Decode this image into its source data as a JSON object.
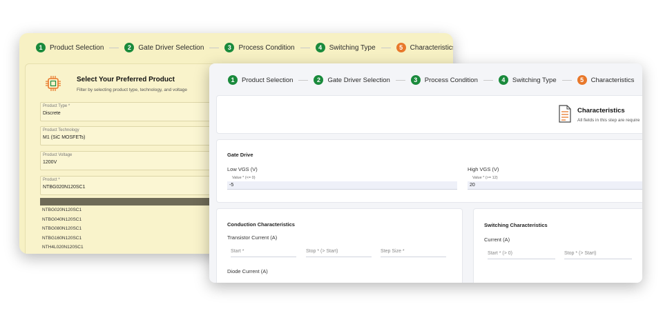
{
  "steps": [
    {
      "num": "1",
      "label": "Product Selection"
    },
    {
      "num": "2",
      "label": "Gate Driver Selection"
    },
    {
      "num": "3",
      "label": "Process Condition"
    },
    {
      "num": "4",
      "label": "Switching Type"
    },
    {
      "num": "5",
      "label": "Characteristics"
    }
  ],
  "product": {
    "title": "Select Your Preferred Product",
    "subtitle": "Filter by selecting product type, technology, and voltage",
    "fields": [
      {
        "label": "Product Type *",
        "value": "Discrete"
      },
      {
        "label": "Product Technology",
        "value": "M1 (SiC MOSFETs)"
      },
      {
        "label": "Product Voltage",
        "value": "1200V"
      },
      {
        "label": "Product *",
        "value": "NTBG020N120SC1"
      }
    ],
    "options": [
      "NTBG020N120SC1",
      "NTBG040N120SC1",
      "NTBG080N120SC1",
      "NTBG160N120SC1",
      "NTH4L020N120SC1"
    ]
  },
  "characteristics": {
    "title": "Characteristics",
    "subtitle": "All fields in this step are require"
  },
  "gate_drive": {
    "title": "Gate Drive",
    "low_label": "Low VGS (V)",
    "low_hint": "Value * (<= 0)",
    "low_value": "-5",
    "high_label": "High VGS (V)",
    "high_hint": "Value * (>= 12)",
    "high_value": "20"
  },
  "conduction": {
    "title": "Conduction Characteristics",
    "transistor_label": "Transistor Current (A)",
    "start_ph": "Start *",
    "stop_ph": "Stop * (> Start)",
    "step_ph": "Step Size *",
    "diode_label": "Diode Current (A)"
  },
  "switching": {
    "title": "Switching Characteristics",
    "current_label": "Current (A)",
    "start_ph": "Start * (> 0)",
    "stop_ph": "Stop * (> Start)"
  },
  "colors": {
    "step_done": "#1a8a3c",
    "step_active": "#e8782b",
    "back_card": "#f7f1c4"
  }
}
